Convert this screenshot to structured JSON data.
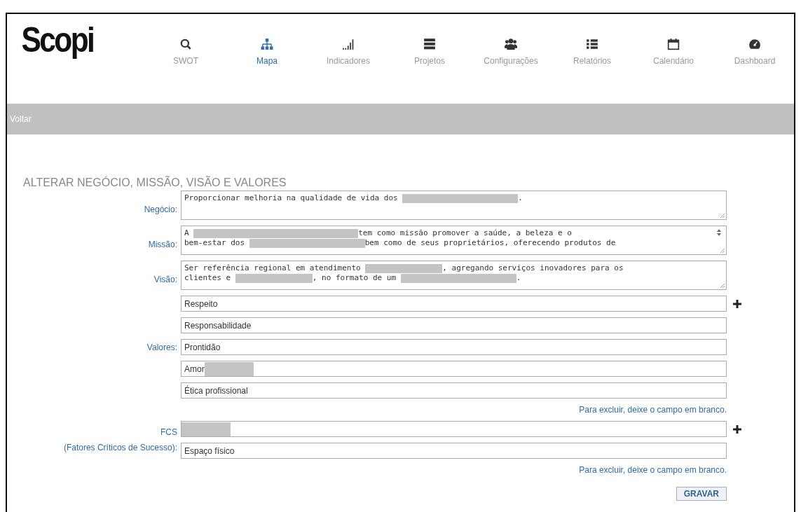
{
  "logo": "Scopi",
  "nav": [
    {
      "label": "SWOT",
      "selected": false
    },
    {
      "label": "Mapa",
      "selected": true
    },
    {
      "label": "Indicadores",
      "selected": false
    },
    {
      "label": "Projetos",
      "selected": false
    },
    {
      "label": "Configurações",
      "selected": false
    },
    {
      "label": "Relatórios",
      "selected": false
    },
    {
      "label": "Calendário",
      "selected": false
    },
    {
      "label": "Dashboard",
      "selected": false
    }
  ],
  "back_bar": {
    "link": "Voltar"
  },
  "form": {
    "title": "ALTERAR NEGÓCIO, MISSÃO, VISÃO E VALORES",
    "text_fields": [
      {
        "label": "Negócio:",
        "scrollbar": false,
        "lines": [
          [
            {
              "kind": "text",
              "text": "Proporcionar melhoria na qualidade de vida dos "
            },
            {
              "kind": "redaction"
            },
            {
              "kind": "text",
              "text": "."
            }
          ]
        ]
      },
      {
        "label": "Missão:",
        "scrollbar": true,
        "lines": [
          [
            {
              "kind": "text",
              "text": "A "
            },
            {
              "kind": "redaction"
            },
            {
              "kind": "text",
              "text": "tem como missão promover a saúde, a beleza e o"
            }
          ],
          [
            {
              "kind": "text",
              "text": "bem-estar dos "
            },
            {
              "kind": "redaction"
            },
            {
              "kind": "text",
              "text": "bem como de seus proprietários, oferecendo produtos de"
            }
          ]
        ]
      },
      {
        "label": "Visão:",
        "scrollbar": false,
        "lines": [
          [
            {
              "kind": "text",
              "text": "Ser referência regional em atendimento "
            },
            {
              "kind": "redaction"
            },
            {
              "kind": "text",
              "text": ", agregando serviços inovadores para os"
            }
          ],
          [
            {
              "kind": "text",
              "text": "clientes e "
            },
            {
              "kind": "redaction"
            },
            {
              "kind": "text",
              "text": ", no formato de um "
            },
            {
              "kind": "redaction"
            },
            {
              "kind": "text",
              "text": "."
            }
          ]
        ]
      }
    ],
    "valores": {
      "label": "Valores:",
      "items": [
        {
          "segments": [
            {
              "kind": "text",
              "text": "Respeito"
            }
          ]
        },
        {
          "segments": [
            {
              "kind": "text",
              "text": "Responsabilidade"
            }
          ]
        },
        {
          "segments": [
            {
              "kind": "text",
              "text": "Prontidão"
            }
          ]
        },
        {
          "segments": [
            {
              "kind": "text",
              "text": "Amor"
            },
            {
              "kind": "redaction"
            }
          ]
        },
        {
          "segments": [
            {
              "kind": "text",
              "text": "Ética profissional"
            }
          ]
        }
      ],
      "hint": "Para excluir, deixe o campo em branco."
    },
    "fcs": {
      "label": "FCS",
      "sublabel": "(Fatores Críticos de Sucesso):",
      "items": [
        {
          "segments": [
            {
              "kind": "redaction"
            }
          ]
        },
        {
          "segments": [
            {
              "kind": "text",
              "text": "Espaço físico"
            }
          ]
        }
      ],
      "hint": "Para excluir, deixe o campo em branco."
    },
    "save_button": "GRAVAR"
  }
}
